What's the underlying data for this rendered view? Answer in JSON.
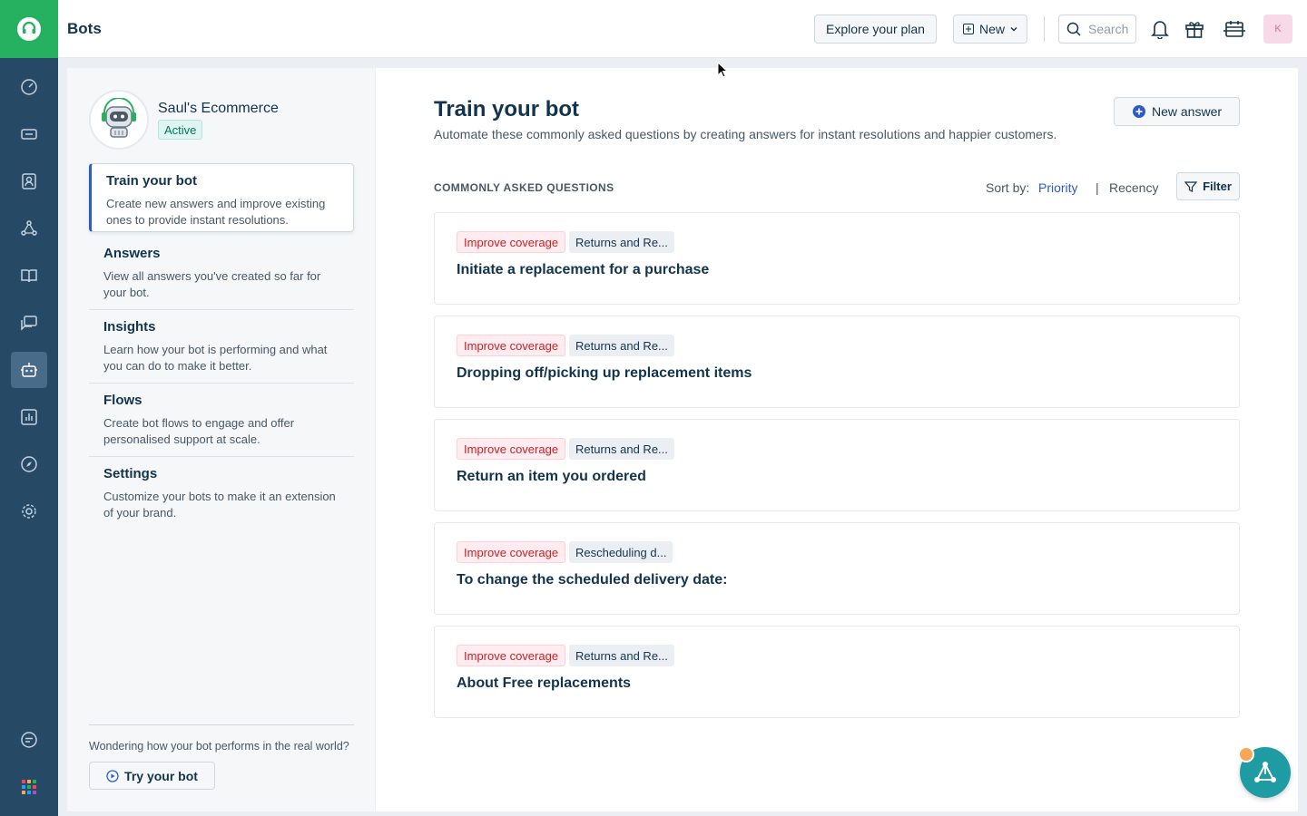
{
  "topbar": {
    "title": "Bots",
    "explore_label": "Explore your plan",
    "new_label": "New",
    "search_placeholder": "Search",
    "avatar_initial": "K"
  },
  "bot": {
    "name": "Saul's Ecommerce",
    "status": "Active"
  },
  "sidebar": {
    "items": [
      {
        "title": "Train your bot",
        "desc": "Create new answers and improve existing ones to provide instant resolutions."
      },
      {
        "title": "Answers",
        "desc": "View all answers you've created so far for your bot."
      },
      {
        "title": "Insights",
        "desc": "Learn how your bot is performing and what you can do to make it better."
      },
      {
        "title": "Flows",
        "desc": "Create bot flows to engage and offer personalised support at scale."
      },
      {
        "title": "Settings",
        "desc": "Customize your bots to make it an extension of your brand."
      }
    ],
    "footer_text": "Wondering how your bot performs in the real world?",
    "try_label": "Try your bot"
  },
  "main": {
    "title": "Train your bot",
    "subtitle": "Automate these commonly asked questions by creating answers for instant resolutions and happier customers.",
    "new_answer_label": "New answer",
    "section_label": "COMMONLY ASKED QUESTIONS",
    "sort_label": "Sort by:",
    "sort_priority": "Priority",
    "sort_separator": "|",
    "sort_recency": "Recency",
    "filter_label": "Filter",
    "questions": [
      {
        "tag": "Improve coverage",
        "category": "Returns and Re...",
        "text": "Initiate a replacement for a purchase"
      },
      {
        "tag": "Improve coverage",
        "category": "Returns and Re...",
        "text": "Dropping off/picking up replacement items"
      },
      {
        "tag": "Improve coverage",
        "category": "Returns and Re...",
        "text": "Return an item you ordered"
      },
      {
        "tag": "Improve coverage",
        "category": "Rescheduling d...",
        "text": "To change the scheduled delivery date:"
      },
      {
        "tag": "Improve coverage",
        "category": "Returns and Re...",
        "text": "About Free replacements"
      }
    ]
  },
  "colors": {
    "rail": "#264966",
    "brand": "#25b15f",
    "accent": "#2c5cc5",
    "coverage_tag": "#c82124"
  }
}
